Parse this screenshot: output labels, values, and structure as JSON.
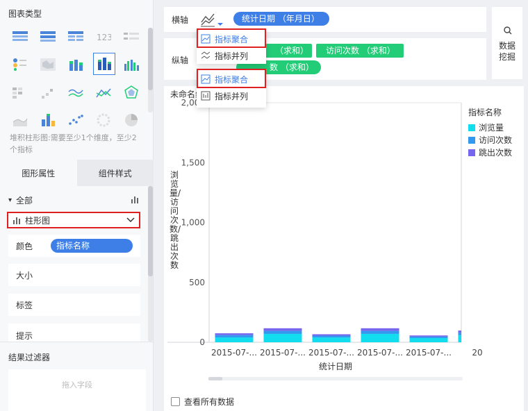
{
  "left_panel": {
    "chart_type_title": "图表类型",
    "hint": "堆积柱形图:需要至少1个维度，至少2个指标",
    "tabs": [
      "图形属性",
      "组件样式"
    ],
    "all_label": "全部",
    "chart_select_label": "柱形图",
    "properties": [
      {
        "label": "颜色",
        "pill": "指标名称"
      },
      {
        "label": "大小"
      },
      {
        "label": "标签"
      },
      {
        "label": "提示"
      }
    ],
    "filter_title": "结果过滤器",
    "drop_placeholder": "拖入字段"
  },
  "axis": {
    "x_label": "横轴",
    "y_label": "纵轴",
    "x_field": "统计日期 （年月日）",
    "y_fields_row1": [
      "（求和）",
      "访问次数 （求和）"
    ],
    "y_field_row2": "数 （求和）",
    "data_mining": "数据挖掘"
  },
  "dropdown_x": {
    "items": [
      "指标聚合",
      "指标并列"
    ],
    "selected": 0
  },
  "dropdown_y": {
    "items": [
      "指标聚合",
      "指标并列"
    ],
    "selected": 0
  },
  "chart_title": "未命名组",
  "show_all_data": "查看所有数据",
  "colors": {
    "accent": "#3d7fe6",
    "green": "#23cc77",
    "red_highlight": "#e02020",
    "series": [
      "#11ddee",
      "#3399ee",
      "#7766ee"
    ]
  },
  "chart_data": {
    "type": "bar",
    "stacked": true,
    "categories": [
      "2015-07-...",
      "2015-07-...",
      "2015-07-...",
      "2015-07-...",
      "2015-07-...",
      "20"
    ],
    "series": [
      {
        "name": "浏览量",
        "values": [
          40,
          70,
          40,
          70,
          35,
          60
        ]
      },
      {
        "name": "访问次数",
        "values": [
          20,
          25,
          15,
          25,
          12,
          20
        ]
      },
      {
        "name": "跳出次数",
        "values": [
          15,
          22,
          12,
          22,
          10,
          18
        ]
      }
    ],
    "yticks": [
      "0",
      "500",
      "1,000",
      "1,500",
      "2,000"
    ],
    "ylim": [
      0,
      2000
    ],
    "xlabel": "统计日期",
    "ylabel": "浏览量/访问次数/跳出次数",
    "legend_title": "指标名称",
    "legend_position": "right"
  }
}
